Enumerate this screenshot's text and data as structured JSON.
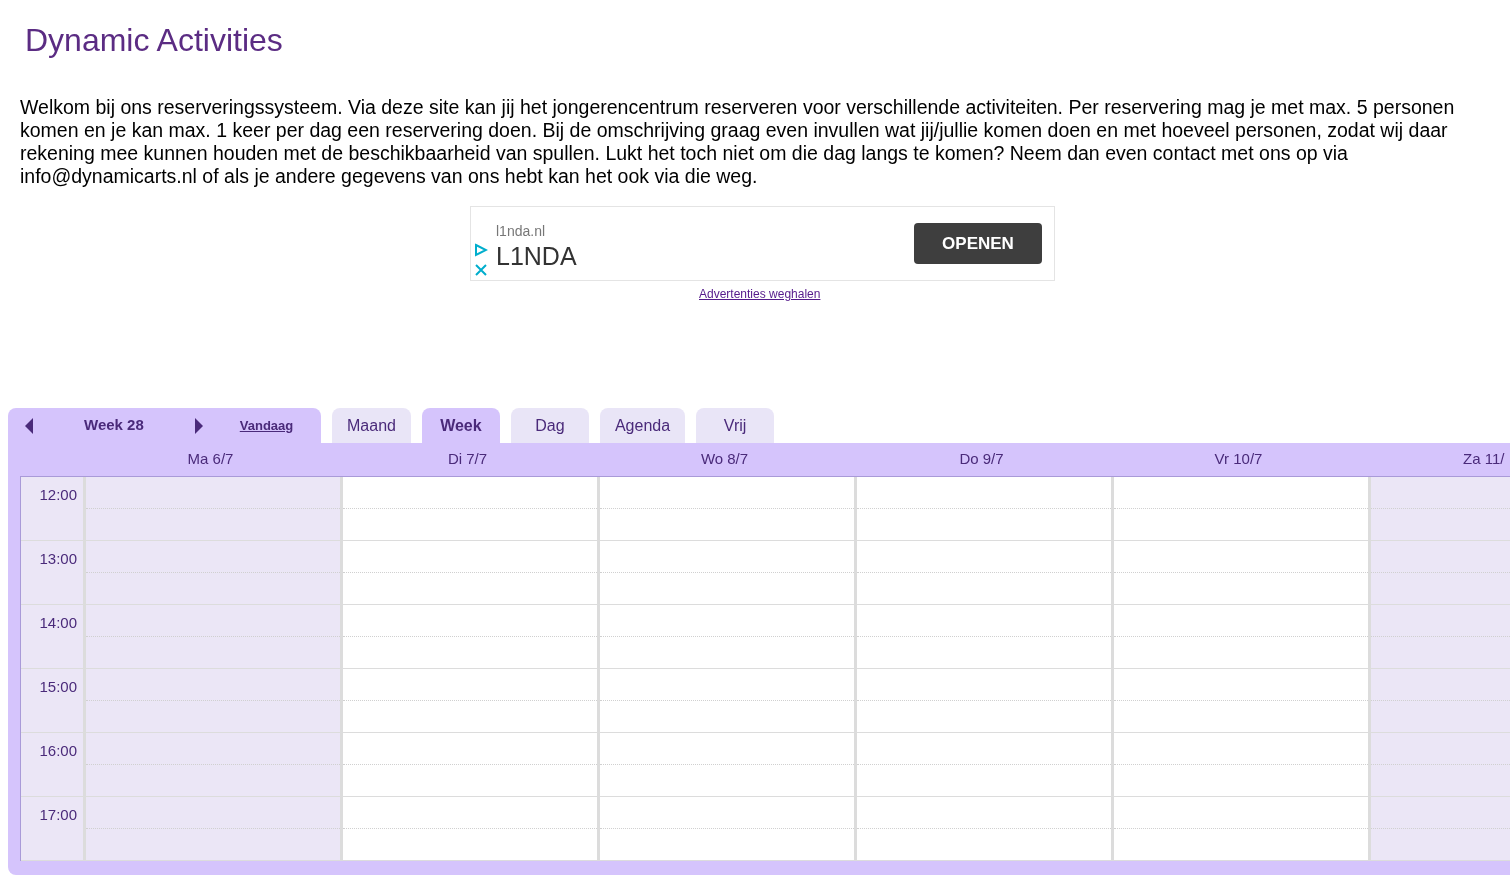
{
  "title": "Dynamic Activities",
  "intro": "Welkom bij ons reserveringssysteem. Via deze site kan jij het jongerencentrum reserveren voor verschillende activiteiten. Per reservering mag je met max. 5 personen komen en je kan max. 1 keer per dag een reservering doen. Bij de omschrijving graag even invullen wat jij/jullie komen doen en met hoeveel personen, zodat wij daar rekening mee kunnen houden met de beschikbaarheid van spullen. Lukt het toch niet om die dag langs te komen? Neem dan even contact met ons op via info@dynamicarts.nl of als je andere gegevens van ons hebt kan het ook via die weg.",
  "ad": {
    "domain": "l1nda.nl",
    "name": "L1NDA",
    "button": "OPENEN",
    "remove_link": "Advertenties weghalen"
  },
  "calendar": {
    "week_label": "Week 28",
    "today": "Vandaag",
    "views": [
      {
        "label": "Maand",
        "selected": false
      },
      {
        "label": "Week",
        "selected": true
      },
      {
        "label": "Dag",
        "selected": false
      },
      {
        "label": "Agenda",
        "selected": false
      },
      {
        "label": "Vrij",
        "selected": false
      }
    ],
    "days": [
      {
        "label": "Ma 6/7",
        "shaded": true
      },
      {
        "label": "Di 7/7",
        "shaded": false
      },
      {
        "label": "Wo 8/7",
        "shaded": false
      },
      {
        "label": "Do 9/7",
        "shaded": false
      },
      {
        "label": "Vr 10/7",
        "shaded": false
      },
      {
        "label": "Za 11/",
        "shaded": true
      }
    ],
    "hours": [
      "12:00",
      "13:00",
      "14:00",
      "15:00",
      "16:00",
      "17:00"
    ]
  }
}
